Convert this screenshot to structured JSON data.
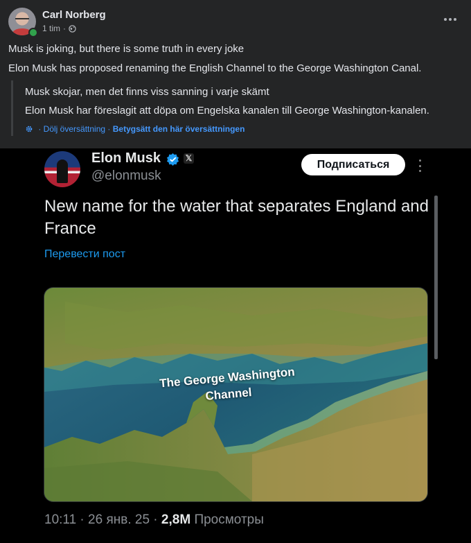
{
  "post": {
    "author": "Carl Norberg",
    "time": "1 tim",
    "separator": "·",
    "line1": "Musk is joking, but there is some truth in every joke",
    "line2": "Elon Musk has proposed renaming the English Channel to the George Washington Canal.",
    "translation": {
      "line1": "Musk skojar, men det finns viss sanning i varje skämt",
      "line2": "Elon Musk har föreslagit att döpa om Engelska kanalen till George Washington-kanalen.",
      "hide_label": "Dölj översättning",
      "rate_label": "Betygsätt den här översättningen"
    },
    "icons": {
      "privacy": "globe-icon",
      "more": "more-icon",
      "translate": "gear-icon"
    }
  },
  "tweet": {
    "name": "Elon Musk",
    "handle": "@elonmusk",
    "subscribe_label": "Подписаться",
    "text": "New name for the water that separates England and France",
    "translate_label": "Перевести пост",
    "image_caption": "The George Washington Channel",
    "time": "10:11",
    "date": "26 янв. 25",
    "views_count": "2,8M",
    "views_label": "Просмотры",
    "dot": "·",
    "icons": {
      "verified": "verified-badge-icon",
      "platform": "x-logo-icon",
      "more": "more-vertical-icon"
    }
  },
  "colors": {
    "background": "#242526",
    "accent": "#4599ff",
    "verified": "#1d9bf0"
  }
}
